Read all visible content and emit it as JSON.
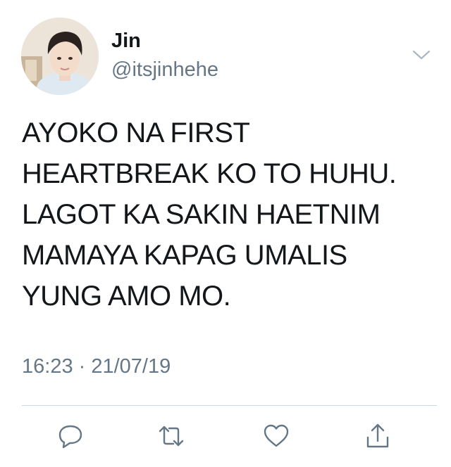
{
  "author": {
    "name": "Jin",
    "handle": "@itsjinhehe"
  },
  "tweet": {
    "lines": [
      "AYOKO NA FIRST",
      "HEARTBREAK KO TO HUHU.",
      "LAGOT KA SAKIN HAETNIM",
      "MAMAYA KAPAG UMALIS",
      "YUNG AMO MO."
    ],
    "timestamp": "16:23 · 21/07/19"
  },
  "icons": {
    "more": "chevron-down-icon",
    "reply": "reply-icon",
    "retweet": "retweet-icon",
    "like": "heart-icon",
    "share": "share-icon"
  },
  "colors": {
    "text": "#14171a",
    "secondary": "#657786",
    "icon": "#657786",
    "divider": "#ccd6dd"
  }
}
